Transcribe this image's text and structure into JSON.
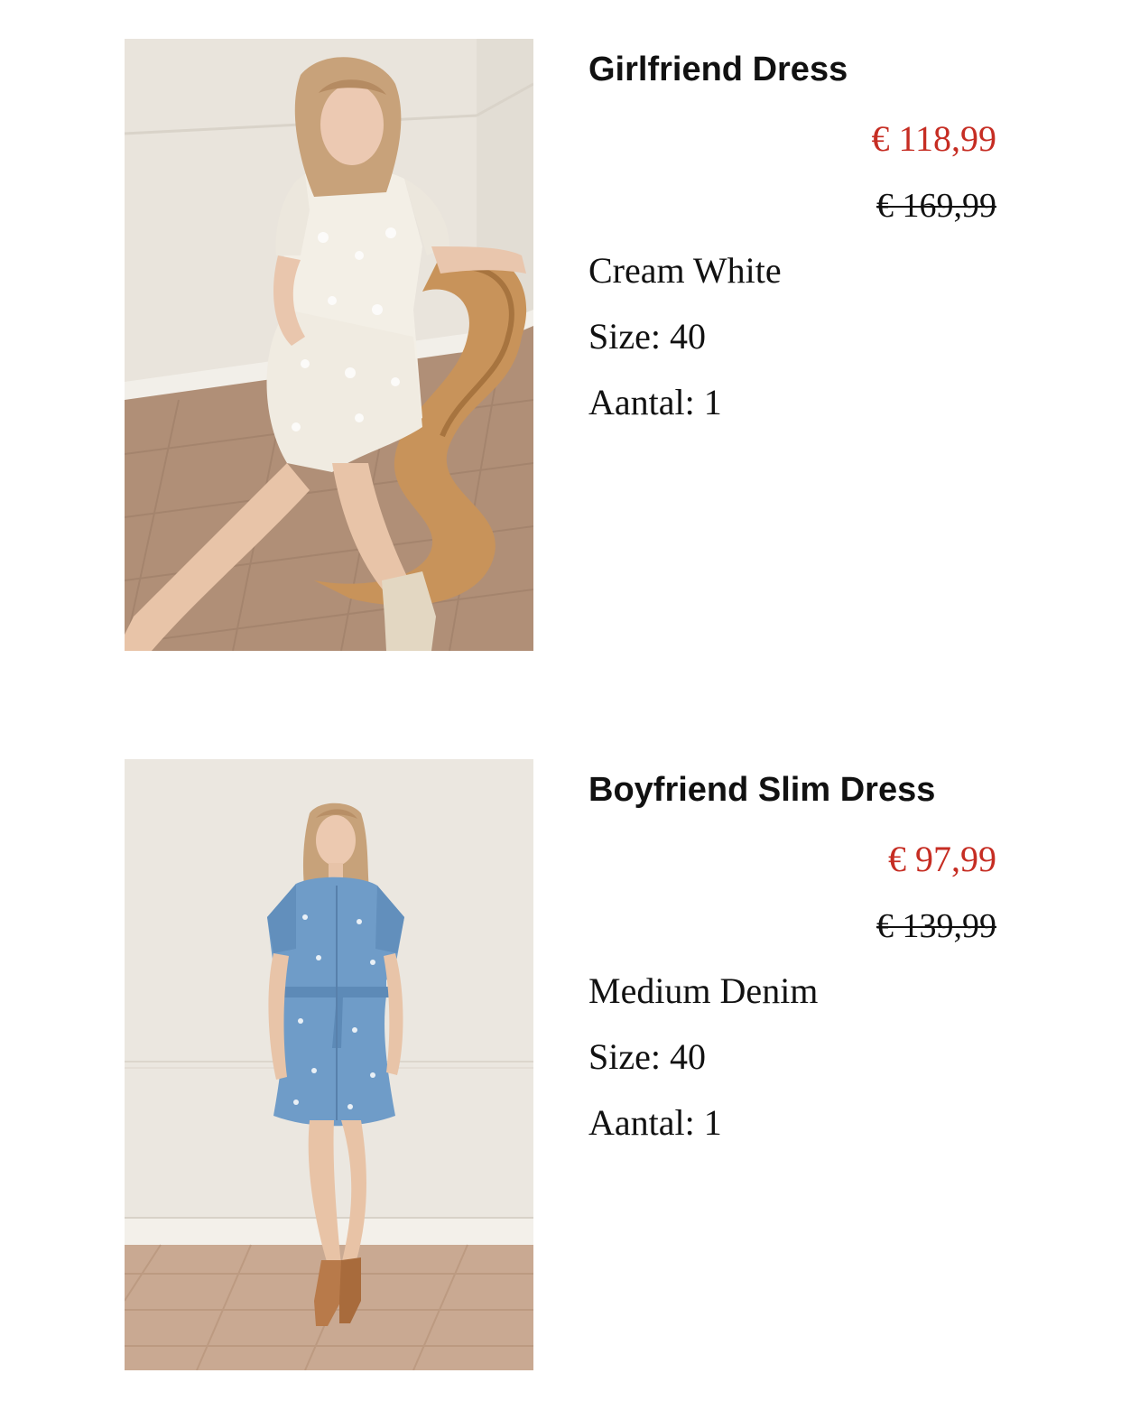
{
  "cart": {
    "items": [
      {
        "name": "Girlfriend Dress",
        "sale_price": "€ 118,99",
        "original_price": "€ 169,99",
        "color": "Cream White",
        "size": "Size: 40",
        "quantity": "Aantal: 1",
        "photo_alt": "woman-in-cream-dress-on-chair-photo"
      },
      {
        "name": "Boyfriend Slim Dress",
        "sale_price": "€ 97,99",
        "original_price": "€ 139,99",
        "color": "Medium Denim",
        "size": "Size: 40",
        "quantity": "Aantal: 1",
        "photo_alt": "woman-in-denim-dress-standing-photo"
      }
    ]
  },
  "colors": {
    "sale_price": "#c62d23",
    "text": "#111111",
    "background": "#ffffff"
  }
}
